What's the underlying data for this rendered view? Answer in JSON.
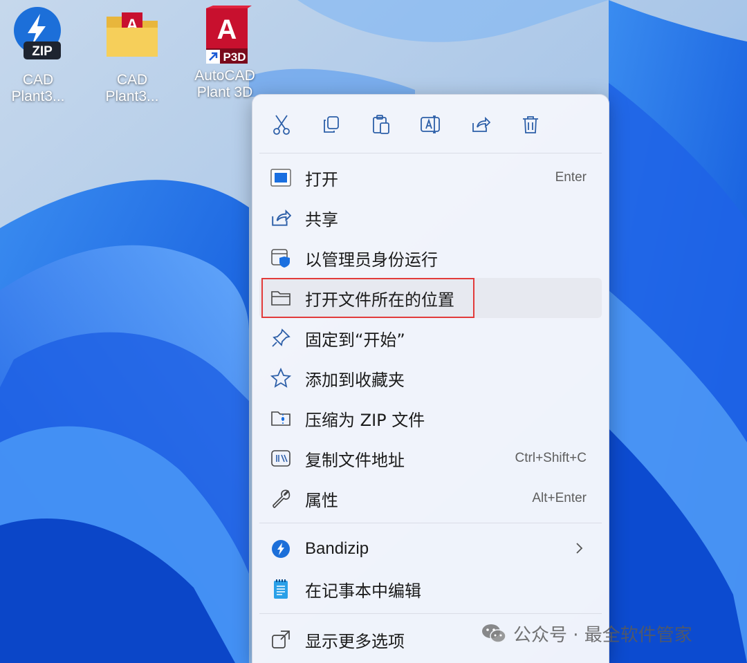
{
  "desktop": {
    "icons": [
      {
        "label_line1": "CAD",
        "label_line2": "Plant3...",
        "badge": "ZIP"
      },
      {
        "label_line1": "CAD",
        "label_line2": "Plant3...",
        "badge": "A"
      },
      {
        "label_line1": "AutoCAD",
        "label_line2": "Plant 3D",
        "badge": "A",
        "sub_badge": "P3D"
      }
    ]
  },
  "context_menu": {
    "toolbar": [
      {
        "icon": "cut-icon"
      },
      {
        "icon": "copy-icon"
      },
      {
        "icon": "paste-icon"
      },
      {
        "icon": "rename-icon"
      },
      {
        "icon": "share-icon"
      },
      {
        "icon": "delete-icon"
      }
    ],
    "items": [
      {
        "label": "打开",
        "shortcut": "Enter",
        "icon": "open-app-icon"
      },
      {
        "label": "共享",
        "shortcut": "",
        "icon": "share-icon"
      },
      {
        "label": "以管理员身份运行",
        "shortcut": "",
        "icon": "shield-icon"
      },
      {
        "label": "打开文件所在的位置",
        "shortcut": "",
        "icon": "folder-icon"
      },
      {
        "label": "固定到“开始”",
        "shortcut": "",
        "icon": "pin-icon"
      },
      {
        "label": "添加到收藏夹",
        "shortcut": "",
        "icon": "star-icon"
      },
      {
        "label": "压缩为 ZIP 文件",
        "shortcut": "",
        "icon": "zip-folder-icon"
      },
      {
        "label": "复制文件地址",
        "shortcut": "Ctrl+Shift+C",
        "icon": "copy-path-icon"
      },
      {
        "label": "属性",
        "shortcut": "Alt+Enter",
        "icon": "wrench-icon"
      },
      {
        "label": "Bandizip",
        "shortcut": "",
        "icon": "bandizip-icon"
      },
      {
        "label": "在记事本中编辑",
        "shortcut": "",
        "icon": "notepad-icon"
      },
      {
        "label": "显示更多选项",
        "shortcut": "",
        "icon": "more-options-icon"
      }
    ]
  },
  "watermark": {
    "text": "公众号 · 最全软件管家"
  },
  "colors": {
    "accent": "#1a6fe0",
    "highlight_border": "#e23a3a",
    "menu_bg": "#f3f5fb"
  }
}
